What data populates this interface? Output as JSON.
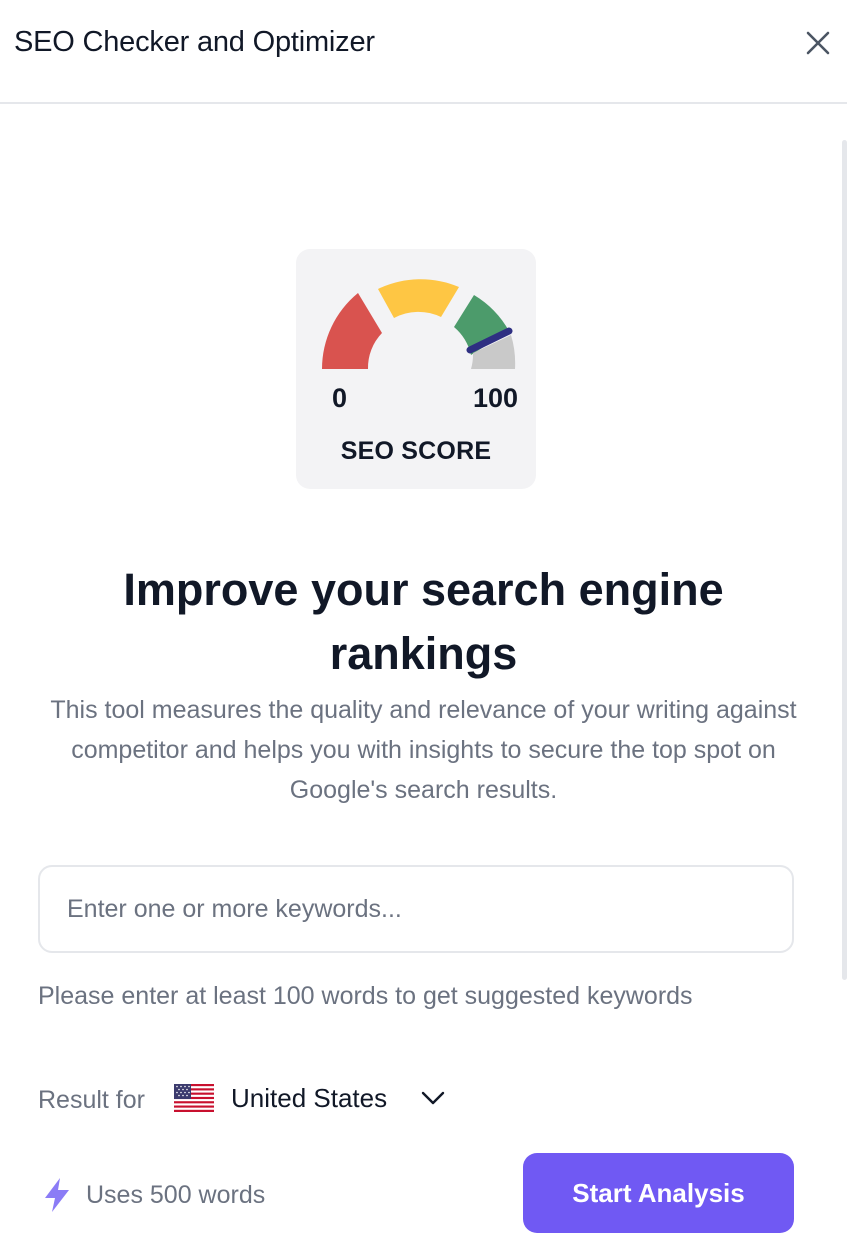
{
  "header": {
    "title": "SEO Checker and Optimizer",
    "close_icon": "close-icon"
  },
  "gauge": {
    "min_label": "0",
    "max_label": "100",
    "label": "SEO SCORE",
    "segment_colors": [
      "#d9534f",
      "#fec644",
      "#4c9b6b",
      "#c9c9c9"
    ],
    "needle_color": "#2e2f82"
  },
  "main": {
    "headline": "Improve your search engine rankings",
    "description": "This tool measures the quality and relevance of your writing against competitor and helps you with insights to secure the top spot on Google's search results."
  },
  "keyword_input": {
    "value": "",
    "placeholder": "Enter one or more keywords..."
  },
  "hint": "Please enter at least 100 words to get suggested keywords",
  "result_for": {
    "label": "Result for",
    "country": "United States",
    "flag_icon": "us-flag-icon",
    "dropdown_icon": "chevron-down-icon"
  },
  "footer": {
    "uses_icon": "lightning-icon",
    "uses_text": "Uses 500 words",
    "start_button_label": "Start Analysis"
  },
  "colors": {
    "accent": "#7059f3",
    "text_primary": "#111827",
    "text_secondary": "#6b7280",
    "card_bg": "#f3f3f5"
  }
}
